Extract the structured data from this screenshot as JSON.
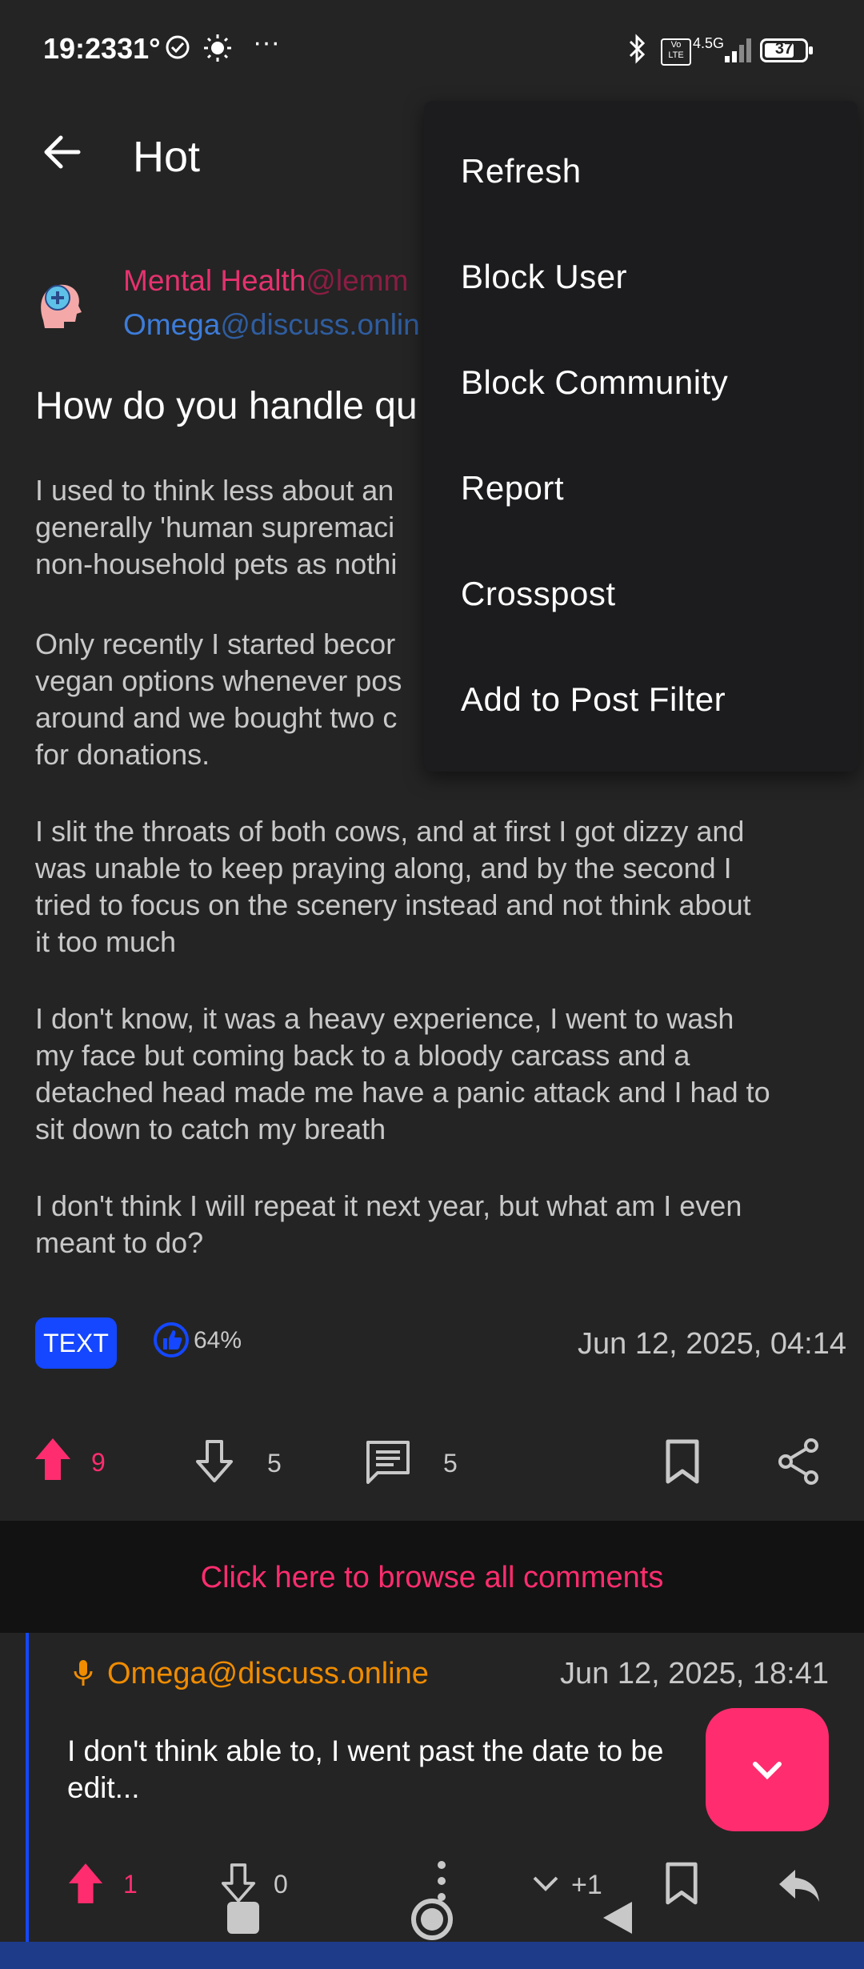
{
  "status_bar": {
    "time": "19:23",
    "temperature": "31°",
    "more": "···",
    "network": "4.5G",
    "volte": "Vo LTE",
    "battery": "37"
  },
  "app_bar": {
    "title": "Hot"
  },
  "post": {
    "community": "Mental Health",
    "community_instance": "@lemm",
    "author": "Omega",
    "author_instance": "@discuss.onlin",
    "title": "How do you handle qu",
    "paragraphs": [
      [
        "I used to think less about an",
        "generally 'human supremaci",
        "non-household pets as nothi"
      ],
      [
        "Only recently I started becor",
        "vegan options whenever pos",
        "around and we bought two c",
        "for donations."
      ],
      [
        "I slit the throats of both cows, and at first I got dizzy and",
        "was unable to keep praying along, and by the second I",
        "tried to focus on the scenery instead and not think about",
        "it too much"
      ],
      [
        "I don't know, it was a heavy experience, I went to wash",
        "my face but coming back to a bloody carcass and a",
        "detached head made me have a panic attack and I had to",
        "sit down to catch my breath"
      ],
      [
        "I don't think I will repeat it next year, but what am I even",
        "meant to do?"
      ]
    ],
    "type_tag": "TEXT",
    "upvote_ratio": "64%",
    "date": "Jun 12, 2025, 04:14",
    "upvotes": "9",
    "downvotes": "5",
    "comments": "5"
  },
  "browse_comments": "Click here to browse all comments",
  "comment": {
    "author": "Omega@discuss.online",
    "date": "Jun 12, 2025, 18:41",
    "body_lines": [
      "I don't think able to, I went past the date to be",
      "edit..."
    ],
    "upvotes": "1",
    "downvotes": "0",
    "children": "+1"
  },
  "menu": {
    "items": [
      "Refresh",
      "Block User",
      "Block Community",
      "Report",
      "Crosspost",
      "Add to Post Filter"
    ]
  },
  "colors": {
    "accent": "#ff2d6f",
    "community": "#e5326e",
    "user": "#3d7cd9",
    "tag": "#1447ff",
    "comment_author": "#f08c00"
  }
}
